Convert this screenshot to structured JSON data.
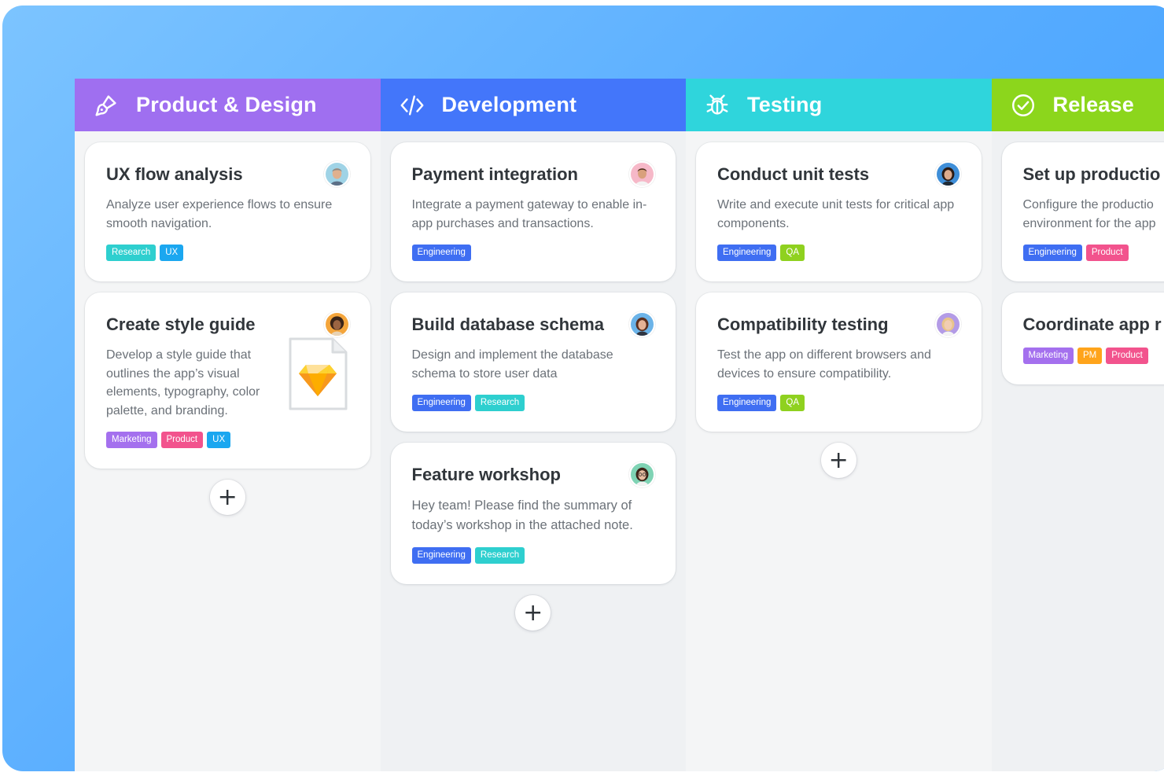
{
  "columns": [
    {
      "title": "Product & Design",
      "icon": "brush-icon",
      "color": "#9f6ff0",
      "cards": [
        {
          "title": "UX flow analysis",
          "desc": "Analyze user experience flows to ensure smooth navigation.",
          "tags": [
            "Research",
            "UX"
          ],
          "avatar": "man-grey-hair-avatar"
        },
        {
          "title": "Create style guide",
          "desc": "Develop a style guide that outlines the app’s visual elements, typography, color palette, and branding.",
          "tags": [
            "Marketing",
            "Product",
            "UX"
          ],
          "avatar": "woman-curly-hair-avatar",
          "attachment": "sketch-file-icon"
        }
      ]
    },
    {
      "title": "Development",
      "icon": "code-icon",
      "color": "#4376fa",
      "cards": [
        {
          "title": "Payment integration",
          "desc": "Integrate a payment gateway to enable in-app purchases and transactions.",
          "tags": [
            "Engineering"
          ],
          "avatar": "man-dark-hair-avatar"
        },
        {
          "title": "Build database schema",
          "desc": "Design and implement the database schema to store user data",
          "tags": [
            "Engineering",
            "Research"
          ],
          "avatar": "woman-brown-hair-avatar"
        },
        {
          "title": "Feature workshop",
          "desc": "Hey team! Please find the summary of today’s workshop in the attached note.",
          "tags": [
            "Engineering",
            "Research"
          ],
          "avatar": "woman-glasses-avatar"
        }
      ]
    },
    {
      "title": "Testing",
      "icon": "bug-icon",
      "color": "#2fd5dc",
      "cards": [
        {
          "title": "Conduct unit tests",
          "desc": "Write and execute unit tests for critical app components.",
          "tags": [
            "Engineering",
            "QA"
          ],
          "avatar": "woman-dark-hair-avatar"
        },
        {
          "title": "Compatibility testing",
          "desc": "Test the app on different browsers and devices to ensure compatibility.",
          "tags": [
            "Engineering",
            "QA"
          ],
          "avatar": "woman-blonde-avatar"
        }
      ]
    },
    {
      "title": "Release",
      "icon": "check-circle-icon",
      "color": "#8cd61c",
      "cards": [
        {
          "title": "Set up productio",
          "desc": "Configure the productio environment for the app",
          "tags": [
            "Engineering",
            "Product"
          ]
        },
        {
          "title": "Coordinate app r",
          "desc": "",
          "tags": [
            "Marketing",
            "PM",
            "Product"
          ]
        }
      ]
    }
  ],
  "add_label": "+",
  "tag_colors": {
    "Research": "#2ecfcf",
    "UX": "#1ba7f0",
    "Engineering": "#3f6ef2",
    "QA": "#8fd11f",
    "Marketing": "#a470ee",
    "Product": "#f2538d",
    "PM": "#ffa41b"
  }
}
